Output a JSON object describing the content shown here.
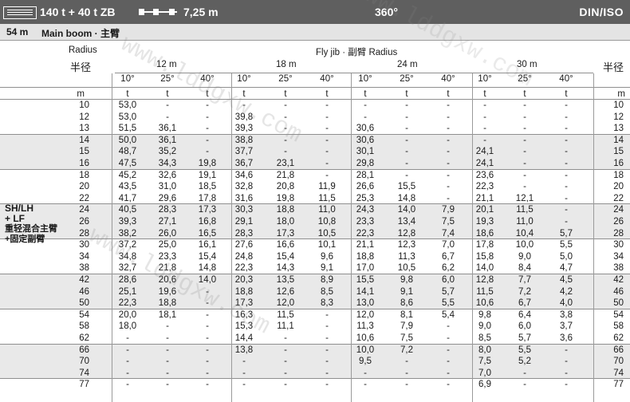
{
  "header": {
    "weights": "140 t + 40 t ZB",
    "reeving": "7,25 m",
    "slewing": "360°",
    "standard": "DIN/ISO"
  },
  "subheader": {
    "boom": "54 m",
    "boom_type": "Main boom · 主臂"
  },
  "table": {
    "radius_en": "Radius",
    "radius_cn": "半径",
    "radius_cn_right": "半径",
    "jib_title": "Fly jib · 副臂 Radius",
    "unit": "m",
    "jib_lengths": [
      "12 m",
      "18 m",
      "24 m",
      "30 m"
    ],
    "angles": [
      "10°",
      "25°",
      "40°",
      "10°",
      "25°",
      "40°",
      "10°",
      "25°",
      "40°",
      "10°",
      "25°",
      "40°"
    ],
    "load_unit": "t",
    "rows": [
      {
        "r": "10",
        "v": [
          "53,0",
          "-",
          "-",
          "-",
          "-",
          "-",
          "-",
          "-",
          "-",
          "-",
          "-",
          "-"
        ]
      },
      {
        "r": "12",
        "v": [
          "53,0",
          "-",
          "-",
          "39,8",
          "-",
          "-",
          "-",
          "-",
          "-",
          "-",
          "-",
          "-"
        ]
      },
      {
        "r": "13",
        "v": [
          "51,5",
          "36,1",
          "-",
          "39,3",
          "-",
          "-",
          "30,6",
          "-",
          "-",
          "-",
          "-",
          "-"
        ]
      },
      {
        "r": "14",
        "v": [
          "50,0",
          "36,1",
          "-",
          "38,8",
          "-",
          "-",
          "30,6",
          "-",
          "-",
          "-",
          "-",
          "-"
        ]
      },
      {
        "r": "15",
        "v": [
          "48,7",
          "35,2",
          "-",
          "37,7",
          "-",
          "-",
          "30,1",
          "-",
          "-",
          "24,1",
          "-",
          "-"
        ]
      },
      {
        "r": "16",
        "v": [
          "47,5",
          "34,3",
          "19,8",
          "36,7",
          "23,1",
          "-",
          "29,8",
          "-",
          "-",
          "24,1",
          "-",
          "-"
        ]
      },
      {
        "r": "18",
        "v": [
          "45,2",
          "32,6",
          "19,1",
          "34,6",
          "21,8",
          "-",
          "28,1",
          "-",
          "-",
          "23,6",
          "-",
          "-"
        ]
      },
      {
        "r": "20",
        "v": [
          "43,5",
          "31,0",
          "18,5",
          "32,8",
          "20,8",
          "11,9",
          "26,6",
          "15,5",
          "-",
          "22,3",
          "-",
          "-"
        ]
      },
      {
        "r": "22",
        "v": [
          "41,7",
          "29,6",
          "17,8",
          "31,6",
          "19,8",
          "11,5",
          "25,3",
          "14,8",
          "-",
          "21,1",
          "12,1",
          "-"
        ]
      },
      {
        "r": "24",
        "v": [
          "40,5",
          "28,3",
          "17,3",
          "30,3",
          "18,8",
          "11,0",
          "24,3",
          "14,0",
          "7,9",
          "20,1",
          "11,5",
          "-"
        ]
      },
      {
        "r": "26",
        "v": [
          "39,3",
          "27,1",
          "16,8",
          "29,1",
          "18,0",
          "10,8",
          "23,3",
          "13,4",
          "7,5",
          "19,3",
          "11,0",
          "-"
        ]
      },
      {
        "r": "28",
        "v": [
          "38,2",
          "26,0",
          "16,5",
          "28,3",
          "17,3",
          "10,5",
          "22,3",
          "12,8",
          "7,4",
          "18,6",
          "10,4",
          "5,7"
        ]
      },
      {
        "r": "30",
        "v": [
          "37,2",
          "25,0",
          "16,1",
          "27,6",
          "16,6",
          "10,1",
          "21,1",
          "12,3",
          "7,0",
          "17,8",
          "10,0",
          "5,5"
        ]
      },
      {
        "r": "34",
        "v": [
          "34,8",
          "23,3",
          "15,4",
          "24,8",
          "15,4",
          "9,6",
          "18,8",
          "11,3",
          "6,7",
          "15,8",
          "9,0",
          "5,0"
        ]
      },
      {
        "r": "38",
        "v": [
          "32,7",
          "21,8",
          "14,8",
          "22,3",
          "14,3",
          "9,1",
          "17,0",
          "10,5",
          "6,2",
          "14,0",
          "8,4",
          "4,7"
        ]
      },
      {
        "r": "42",
        "v": [
          "28,6",
          "20,6",
          "14,0",
          "20,3",
          "13,5",
          "8,9",
          "15,5",
          "9,8",
          "6,0",
          "12,8",
          "7,7",
          "4,5"
        ]
      },
      {
        "r": "46",
        "v": [
          "25,1",
          "19,6",
          "-",
          "18,8",
          "12,6",
          "8,5",
          "14,1",
          "9,1",
          "5,7",
          "11,5",
          "7,2",
          "4,2"
        ]
      },
      {
        "r": "50",
        "v": [
          "22,3",
          "18,8",
          "-",
          "17,3",
          "12,0",
          "8,3",
          "13,0",
          "8,6",
          "5,5",
          "10,6",
          "6,7",
          "4,0"
        ]
      },
      {
        "r": "54",
        "v": [
          "20,0",
          "18,1",
          "-",
          "16,3",
          "11,5",
          "-",
          "12,0",
          "8,1",
          "5,4",
          "9,8",
          "6,4",
          "3,8"
        ]
      },
      {
        "r": "58",
        "v": [
          "18,0",
          "-",
          "-",
          "15,3",
          "11,1",
          "-",
          "11,3",
          "7,9",
          "-",
          "9,0",
          "6,0",
          "3,7"
        ]
      },
      {
        "r": "62",
        "v": [
          "-",
          "-",
          "-",
          "14,4",
          "-",
          "-",
          "10,6",
          "7,5",
          "-",
          "8,5",
          "5,7",
          "3,6"
        ]
      },
      {
        "r": "66",
        "v": [
          "-",
          "-",
          "-",
          "13,8",
          "-",
          "-",
          "10,0",
          "7,2",
          "-",
          "8,0",
          "5,5",
          "-"
        ]
      },
      {
        "r": "70",
        "v": [
          "-",
          "-",
          "-",
          "-",
          "-",
          "-",
          "9,5",
          "-",
          "-",
          "7,5",
          "5,2",
          "-"
        ]
      },
      {
        "r": "74",
        "v": [
          "-",
          "-",
          "-",
          "-",
          "-",
          "-",
          "-",
          "-",
          "-",
          "7,0",
          "-",
          "-"
        ]
      },
      {
        "r": "77",
        "v": [
          "-",
          "-",
          "-",
          "-",
          "-",
          "-",
          "-",
          "-",
          "-",
          "6,9",
          "-",
          "-"
        ]
      }
    ]
  },
  "side_label": {
    "line1": "SH/LH",
    "line2": "+ LF",
    "line3": "重轻混合主臂",
    "line4": "+固定副臂"
  },
  "watermark": {
    "text": "www.lddgxw.com"
  }
}
